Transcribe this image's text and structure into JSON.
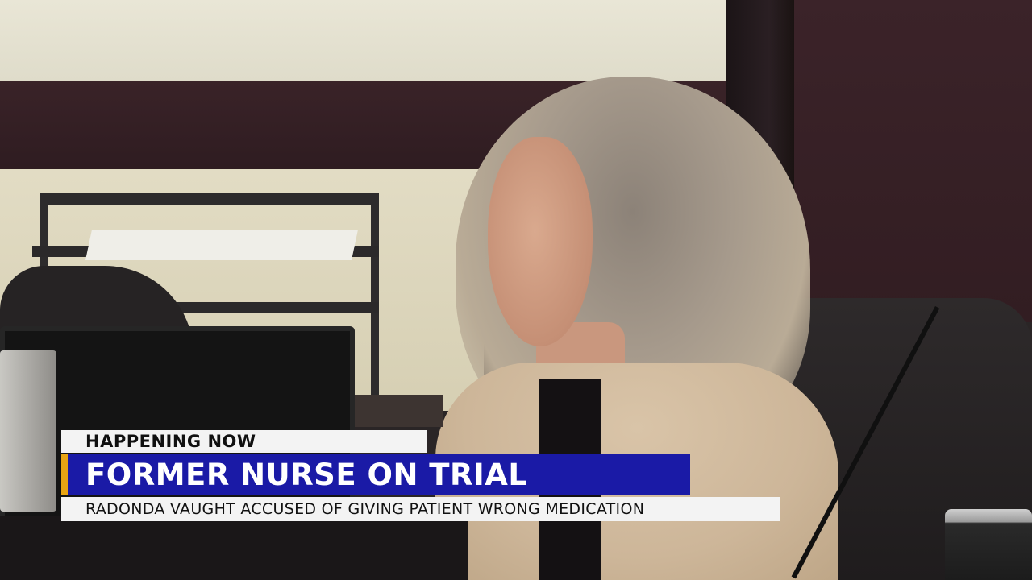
{
  "lower_third": {
    "kicker": "HAPPENING NOW",
    "headline": "FORMER NURSE ON TRIAL",
    "subheadline": "RADONDA VAUGHT ACCUSED OF GIVING PATIENT WRONG MEDICATION"
  },
  "colors": {
    "headline_bar": "#1a1aa6",
    "accent": "#e8a514",
    "kicker_bar": "#f3f3f3"
  }
}
